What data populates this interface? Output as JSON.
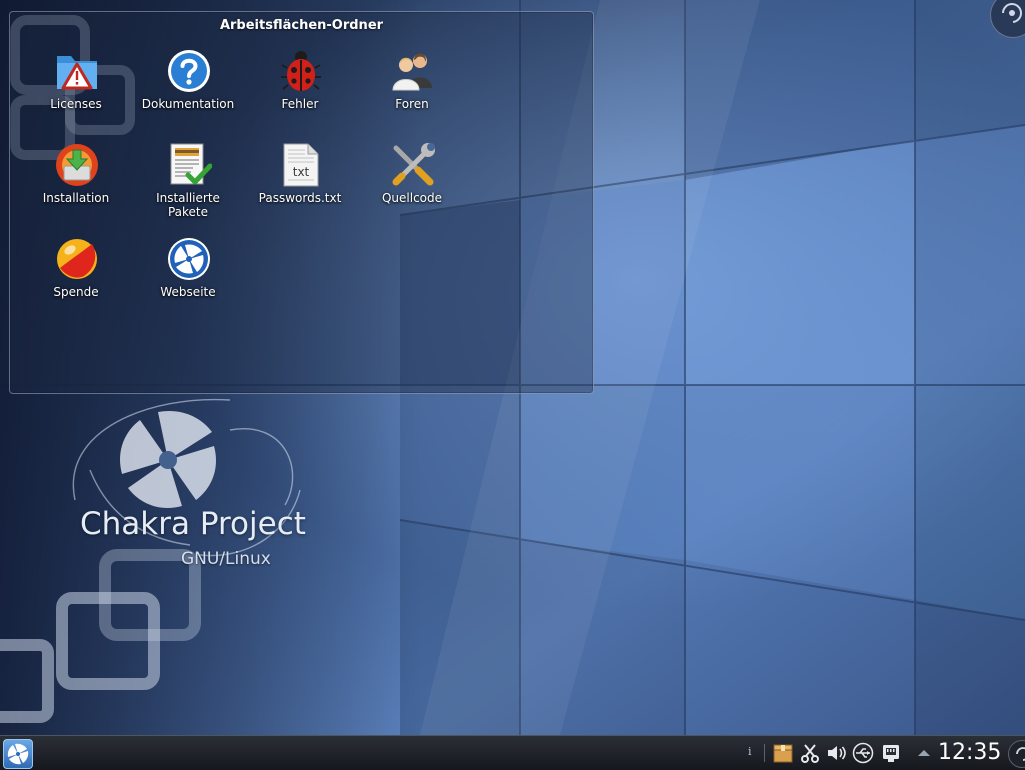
{
  "folder_view": {
    "title": "Arbeitsflächen-Ordner",
    "items": [
      {
        "label": "Licenses",
        "icon": "folder-warning-icon"
      },
      {
        "label": "Dokumentation",
        "icon": "help-icon"
      },
      {
        "label": "Fehler",
        "icon": "ladybug-icon"
      },
      {
        "label": "Foren",
        "icon": "users-icon"
      },
      {
        "label": "Installation",
        "icon": "installer-icon"
      },
      {
        "label": "Installierte\nPakete",
        "icon": "installed-packages-icon"
      },
      {
        "label": "Passwords.txt",
        "icon": "text-file-icon"
      },
      {
        "label": "Quellcode",
        "icon": "tools-icon"
      },
      {
        "label": "Spende",
        "icon": "donate-ball-icon"
      },
      {
        "label": "Webseite",
        "icon": "chakra-web-icon"
      }
    ]
  },
  "wallpaper": {
    "brand_title": "Chakra Project",
    "brand_subtitle": "GNU/Linux"
  },
  "panel": {
    "info_glyph": "i",
    "clock": "12:35"
  },
  "colors": {
    "desktop_blue": "#4a6896",
    "panel_dark": "#1b1e23",
    "accent_blue": "#2e6bb4"
  }
}
